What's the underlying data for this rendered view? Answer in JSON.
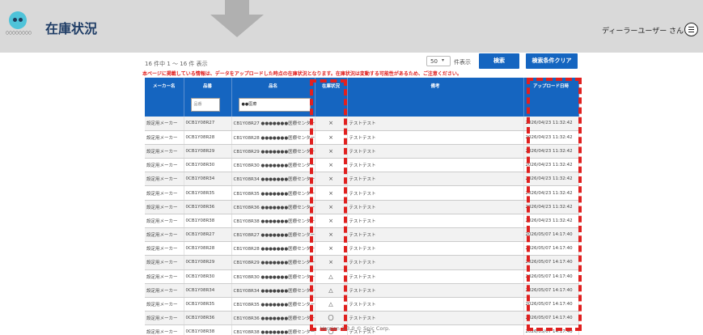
{
  "header": {
    "title": "在庫状況",
    "logo_text": "〇〇〇〇〇〇〇〇",
    "user_label": "ディーラーユーザー さん",
    "menu_icon": "hamburger-menu-icon",
    "background_color": "#d9d9d9"
  },
  "results": {
    "count_text": "16 件中 1 ～ 16 件 表示",
    "notice": "本ページに掲載している情報は、データをアップロードした時点の在庫状況となります。在庫状況は変動する可能性があるため、ご注意ください。",
    "per_page_value": "50",
    "per_page_label": "件表示"
  },
  "buttons": {
    "search": "検索",
    "clear": "検索条件クリア",
    "color": "#1565c0"
  },
  "table": {
    "columns": [
      "メーカー名",
      "品番",
      "品名",
      "在庫状況",
      "備考",
      "アップロード日時"
    ],
    "filters": {
      "part_no_placeholder": "品番",
      "name_value": "●●医療"
    },
    "rows": [
      {
        "maker": "設定用メーカー",
        "part_no": "0CB1Y08R27",
        "name": "CB1Y08R27 ●●●●●●●医療センター",
        "stock": "×",
        "note": "テストテスト",
        "uploaded": "2026/04/23 11:32:42",
        "marker": false
      },
      {
        "maker": "設定用メーカー",
        "part_no": "0CB1Y08R28",
        "name": "CB1Y08R28 ●●●●●●●医療センター",
        "stock": "×",
        "note": "テストテスト",
        "uploaded": "2026/04/23 11:32:42",
        "marker": false
      },
      {
        "maker": "設定用メーカー",
        "part_no": "0CB1Y08R29",
        "name": "CB1Y08R29 ●●●●●●●医療センター",
        "stock": "×",
        "note": "テストテスト",
        "uploaded": "2026/04/23 11:32:42",
        "marker": false
      },
      {
        "maker": "設定用メーカー",
        "part_no": "0CB1Y08R30",
        "name": "CB1Y08R30 ●●●●●●●医療センター",
        "stock": "×",
        "note": "テストテスト",
        "uploaded": "2026/04/23 11:32:42",
        "marker": false
      },
      {
        "maker": "設定用メーカー",
        "part_no": "0CB1Y08R34",
        "name": "CB1Y08R34 ●●●●●●●医療センター",
        "stock": "×",
        "note": "テストテスト",
        "uploaded": "2026/04/23 11:32:42",
        "marker": false
      },
      {
        "maker": "設定用メーカー",
        "part_no": "0CB1Y08R35",
        "name": "CB1Y08R35 ●●●●●●●医療センター",
        "stock": "×",
        "note": "テストテスト",
        "uploaded": "2026/04/23 11:32:42",
        "marker": false
      },
      {
        "maker": "設定用メーカー",
        "part_no": "0CB1Y08R36",
        "name": "CB1Y08R36 ●●●●●●●医療センター",
        "stock": "×",
        "note": "テストテスト",
        "uploaded": "2026/04/23 11:32:42",
        "marker": false
      },
      {
        "maker": "設定用メーカー",
        "part_no": "0CB1Y08R38",
        "name": "CB1Y08R38 ●●●●●●●医療センター",
        "stock": "×",
        "note": "テストテスト",
        "uploaded": "2026/04/23 11:32:42",
        "marker": false
      },
      {
        "maker": "設定用メーカー",
        "part_no": "0CB1Y08R27",
        "name": "CB1Y08R27 ●●●●●●●医療センター",
        "stock": "×",
        "note": "テストテスト",
        "uploaded": "2026/05/07 14:17:40",
        "marker": true
      },
      {
        "maker": "設定用メーカー",
        "part_no": "0CB1Y08R28",
        "name": "CB1Y08R28 ●●●●●●●医療センター",
        "stock": "×",
        "note": "テストテスト",
        "uploaded": "2026/05/07 14:17:40",
        "marker": true
      },
      {
        "maker": "設定用メーカー",
        "part_no": "0CB1Y08R29",
        "name": "CB1Y08R29 ●●●●●●●医療センター",
        "stock": "×",
        "note": "テストテスト",
        "uploaded": "2026/05/07 14:17:40",
        "marker": true
      },
      {
        "maker": "設定用メーカー",
        "part_no": "0CB1Y08R30",
        "name": "CB1Y08R30 ●●●●●●●医療センター",
        "stock": "△",
        "note": "テストテスト",
        "uploaded": "2026/05/07 14:17:40",
        "marker": true
      },
      {
        "maker": "設定用メーカー",
        "part_no": "0CB1Y08R34",
        "name": "CB1Y08R34 ●●●●●●●医療センター",
        "stock": "△",
        "note": "テストテスト",
        "uploaded": "2026/05/07 14:17:40",
        "marker": true
      },
      {
        "maker": "設定用メーカー",
        "part_no": "0CB1Y08R35",
        "name": "CB1Y08R35 ●●●●●●●医療センター",
        "stock": "△",
        "note": "テストテスト",
        "uploaded": "2026/05/07 14:17:40",
        "marker": true
      },
      {
        "maker": "設定用メーカー",
        "part_no": "0CB1Y08R36",
        "name": "CB1Y08R36 ●●●●●●●医療センター",
        "stock": "〇",
        "note": "テストテスト",
        "uploaded": "2026/05/07 14:17:40",
        "marker": true
      },
      {
        "maker": "設定用メーカー",
        "part_no": "0CB1Y08R38",
        "name": "CB1Y08R38 ●●●●●●●医療センター",
        "stock": "〇",
        "note": "テストテスト",
        "uploaded": "2026/05/07 14:17:40",
        "marker": true
      }
    ]
  },
  "annotation_color": "#e0201f",
  "footer": {
    "version": "Version 1.3.0 © Spic Corp."
  }
}
